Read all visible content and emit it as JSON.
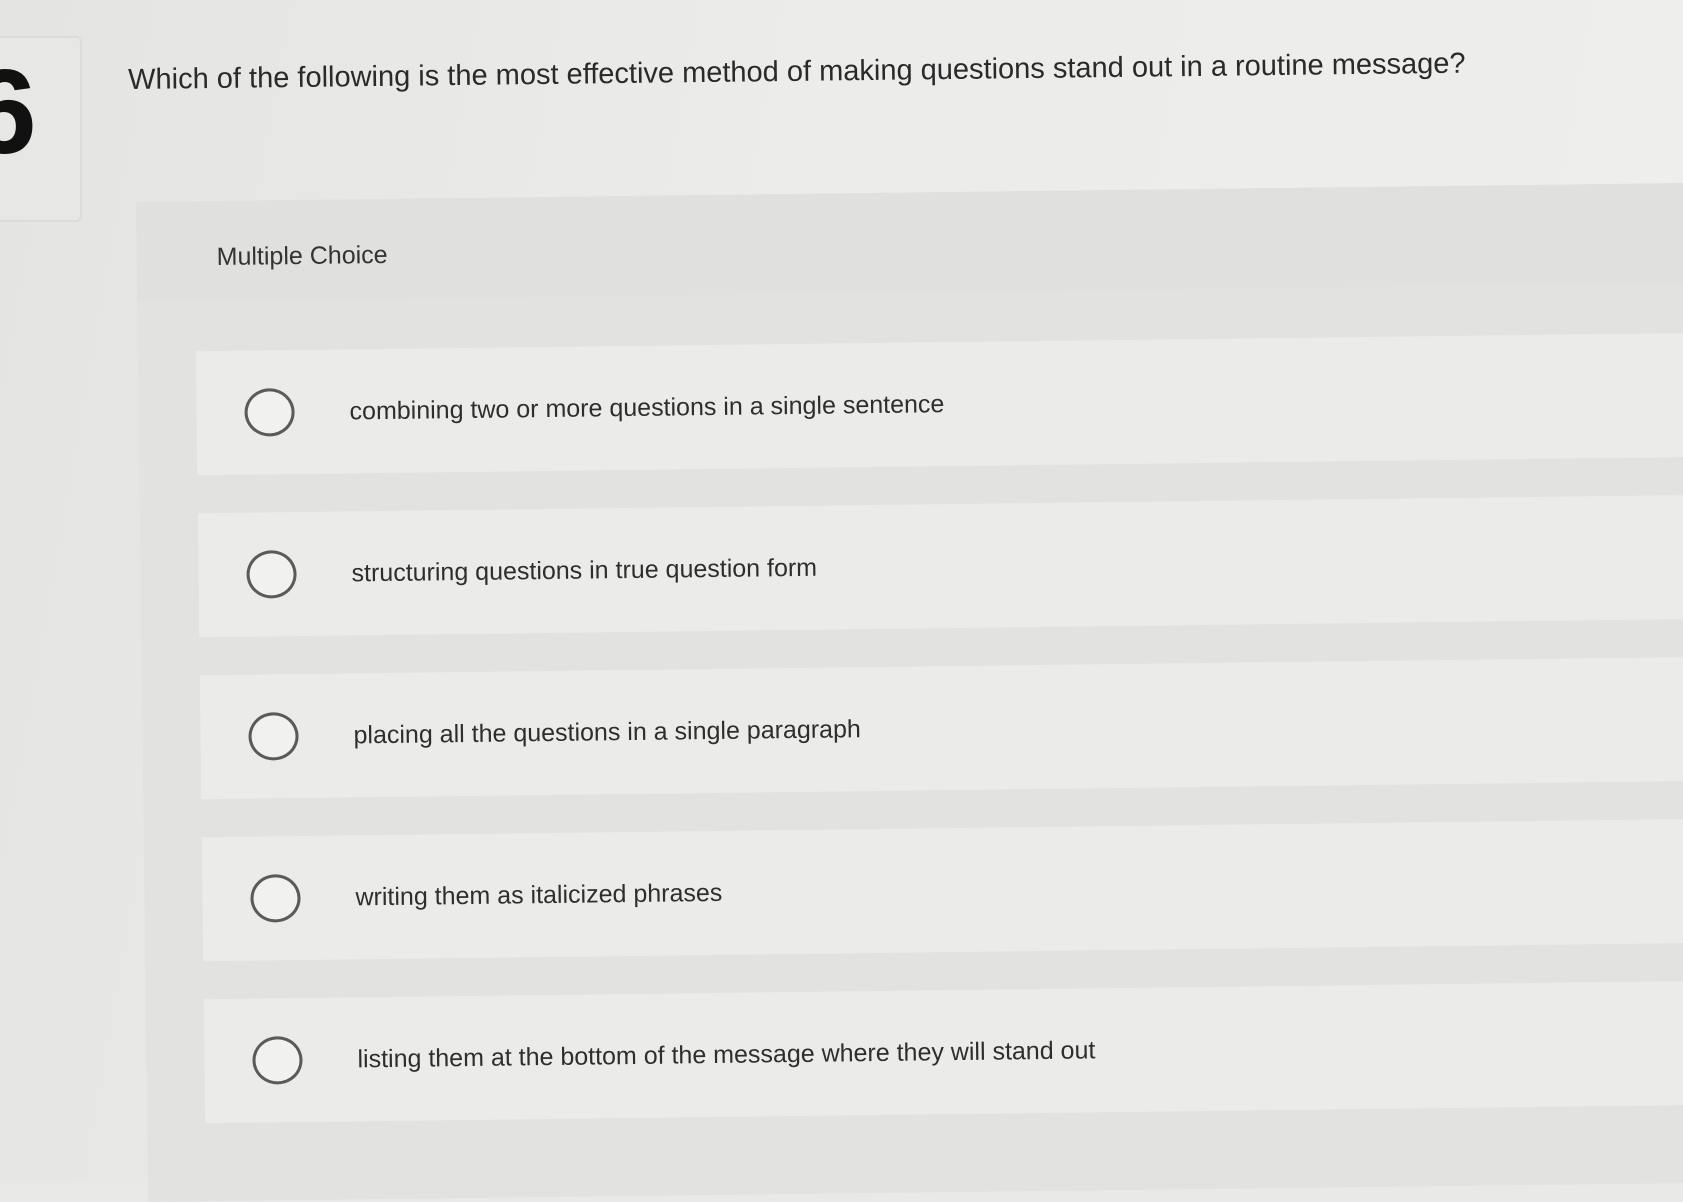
{
  "question": {
    "number": "6",
    "text": "Which of the following is the most effective method of making questions stand out in a routine message?"
  },
  "choices_section": {
    "label": "Multiple Choice",
    "options": [
      {
        "label": "combining two or more questions in a single sentence",
        "selected": false
      },
      {
        "label": "structuring questions in true question form",
        "selected": false
      },
      {
        "label": "placing all the questions in a single paragraph",
        "selected": false
      },
      {
        "label": "writing them as italicized phrases",
        "selected": false
      },
      {
        "label": "listing them at the bottom of the message where they will stand out",
        "selected": false
      }
    ]
  }
}
